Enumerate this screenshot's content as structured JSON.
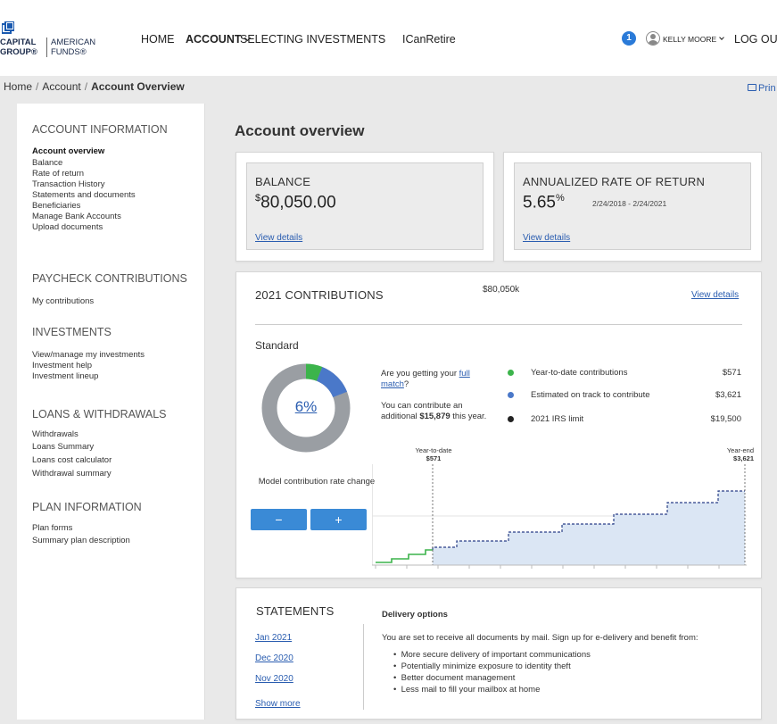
{
  "header": {
    "logo_left": "CAPITAL\nGROUP®",
    "logo_right": "AMERICAN\nFUNDS®",
    "nav": [
      "HOME",
      "ACCOUNT",
      "SELECTING INVESTMENTS",
      "ICanRetire"
    ],
    "notifications": "1",
    "user": "KELLY MOORE",
    "logout": "LOG OUT"
  },
  "breadcrumb": {
    "home": "Home",
    "account": "Account",
    "current": "Account Overview",
    "print": "Prin"
  },
  "sidebar": {
    "sections": [
      {
        "title": "ACCOUNT INFORMATION",
        "items": [
          "Account overview",
          "Balance",
          "Rate of return",
          "Transaction History",
          "Statements and documents",
          "Beneficiaries",
          "Manage Bank Accounts",
          "Upload documents"
        ]
      },
      {
        "title": "PAYCHECK CONTRIBUTIONS",
        "items": [
          "My contributions"
        ]
      },
      {
        "title": "INVESTMENTS",
        "items": [
          "View/manage my investments",
          "Investment help",
          "Investment lineup"
        ]
      },
      {
        "title": "LOANS & WITHDRAWALS",
        "items": [
          "Withdrawals",
          "Loans Summary",
          "Loans cost calculator",
          "Withdrawal summary"
        ]
      },
      {
        "title": "PLAN INFORMATION",
        "items": [
          "Plan forms",
          "Summary plan description"
        ]
      }
    ]
  },
  "main": {
    "title": "Account overview",
    "balance": {
      "label": "BALANCE",
      "currency": "$",
      "value": "80,050.00",
      "link": "View details"
    },
    "return": {
      "label": "ANNUALIZED RATE OF RETURN",
      "value": "5.65",
      "unit": "%",
      "period": "2/24/2018 - 2/24/2021",
      "link": "View details"
    },
    "contributions": {
      "title": "2021 CONTRIBUTIONS",
      "amount": "$80,050k",
      "link": "View details",
      "standard": "Standard",
      "rate": "6%",
      "rate_fraction": 0.06,
      "estimated_fraction": 0.13,
      "q_prefix": "Are you getting your ",
      "q_link": "full match",
      "q_suffix": "?",
      "add_prefix": "You can contribute an additional ",
      "add_amount": "$15,879",
      "add_suffix": " this year.",
      "model_label": "Model contribution rate change",
      "minus": "−",
      "plus": "+",
      "legend": [
        {
          "label": "Year-to-date contributions",
          "value": "$571",
          "color": "#3cb44b"
        },
        {
          "label": "Estimated on track to contribute",
          "value": "$3,621",
          "color": "#4a78c9"
        },
        {
          "label": "2021 IRS limit",
          "value": "$19,500",
          "color": "#222222"
        }
      ],
      "chart": {
        "ytd_label": "Year-to-date",
        "ytd_value": "$571",
        "ye_label": "Year-end",
        "ye_value": "$3,621"
      }
    },
    "statements": {
      "title": "STATEMENTS",
      "links": [
        "Jan 2021",
        "Dec 2020",
        "Nov 2020"
      ],
      "show_more": "Show more",
      "delivery_title": "Delivery options",
      "delivery_text": "You are set to receive all documents by mail. Sign up for e-delivery and benefit from:",
      "bullets": [
        "More secure delivery of important communications",
        "Potentially minimize exposure to identity theft",
        "Better document management",
        "Less mail to fill your mailbox at home"
      ]
    }
  }
}
